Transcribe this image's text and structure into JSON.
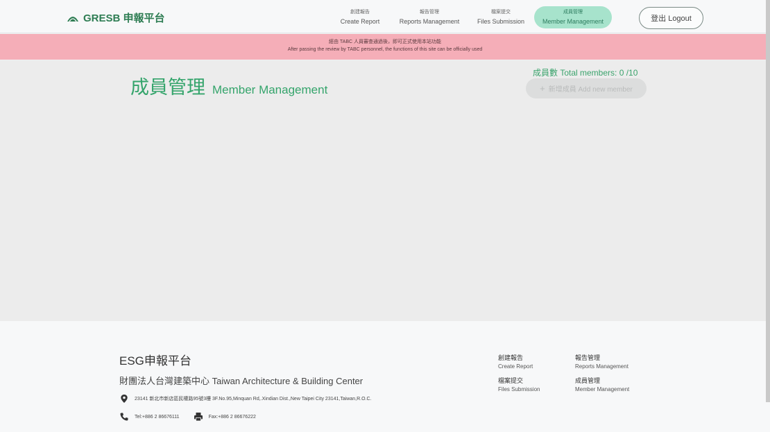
{
  "header": {
    "brand": "GRESB 申報平台",
    "nav": [
      {
        "zh": "創建報告",
        "en": "Create Report"
      },
      {
        "zh": "報告管理",
        "en": "Reports Management"
      },
      {
        "zh": "檔案提交",
        "en": "Files Submission"
      },
      {
        "zh": "成員管理",
        "en": "Member Management"
      }
    ],
    "logout_label": "登出 Logout"
  },
  "notice": {
    "zh": "經由 TABC 人員審查通過後，即可正式使用本站功能",
    "en": "After passing the review by TABC personnel, the functions of this site can be officially used"
  },
  "main": {
    "title_zh": "成員管理",
    "title_en": "Member Management",
    "member_count": "成員數 Total members: 0 /10",
    "add_member_label": "新增成員 Add new member"
  },
  "footer": {
    "title": "ESG申報平台",
    "org": "財團法人台灣建築中心 Taiwan Architecture & Building Center",
    "address": "23141 新北市新店區民權路95號3樓 3F.No.95,Minquan Rd,.Xindian Dist.,New Taipei City 23141,Taiwan,R.O.C.",
    "tel": "Tel:+886 2 86676111",
    "fax": "Fax:+886 2 86676222",
    "links": [
      {
        "zh": "創建報告",
        "en": "Create Report"
      },
      {
        "zh": "報告管理",
        "en": "Reports Management"
      },
      {
        "zh": "檔案提交",
        "en": "Files Submission"
      },
      {
        "zh": "成員管理",
        "en": "Member Management"
      }
    ]
  },
  "colors": {
    "brand": "#2e7d53",
    "accent": "#34a46b",
    "active_nav_bg": "#a7e3cc",
    "notice_bg": "#f5aeb8"
  },
  "icons": [
    "dome-logo-icon",
    "location-pin-icon",
    "phone-icon",
    "fax-printer-icon",
    "plus-icon"
  ]
}
